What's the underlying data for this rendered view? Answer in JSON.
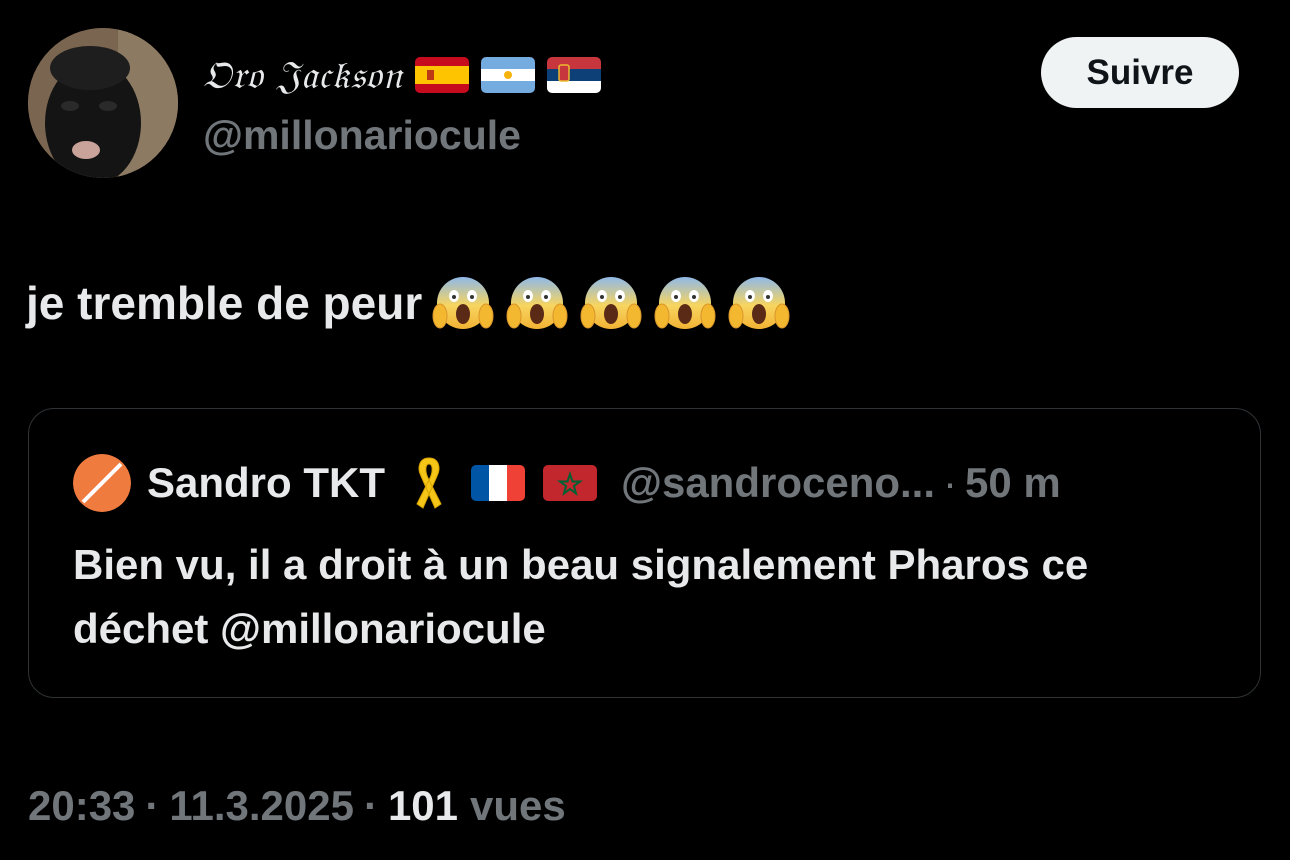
{
  "author": {
    "display_name": "𝔒𝔯𝔬 𝔍𝔞𝔠𝔨𝔰𝔬𝔫",
    "handle": "@millonariocule",
    "flags": [
      "spain-flag-icon",
      "argentina-flag-icon",
      "serbia-flag-icon"
    ]
  },
  "follow_button": {
    "label": "Suivre"
  },
  "tweet": {
    "text": "je tremble de peur",
    "emojis": [
      "😱",
      "😱",
      "😱",
      "😱",
      "😱"
    ]
  },
  "quote": {
    "name": "Sandro TKT",
    "icons": [
      "yellow-ribbon-icon",
      "france-flag-icon",
      "morocco-flag-icon"
    ],
    "handle": "@sandroceno...",
    "separator": "·",
    "time": "50 m",
    "body": "Bien vu, il a droit à un beau signalement Pharos ce déchet @millonariocule"
  },
  "meta": {
    "time": "20:33",
    "date": "11.3.2025",
    "separator": "·",
    "views_count": "101",
    "views_label": "vues"
  },
  "colors": {
    "background": "#000000",
    "text_primary": "#e7e9ea",
    "text_secondary": "#71767b",
    "border": "#2f3336",
    "button_bg": "#eff3f4",
    "button_text": "#0f1419",
    "quote_avatar_accent": "#f07b3f"
  }
}
